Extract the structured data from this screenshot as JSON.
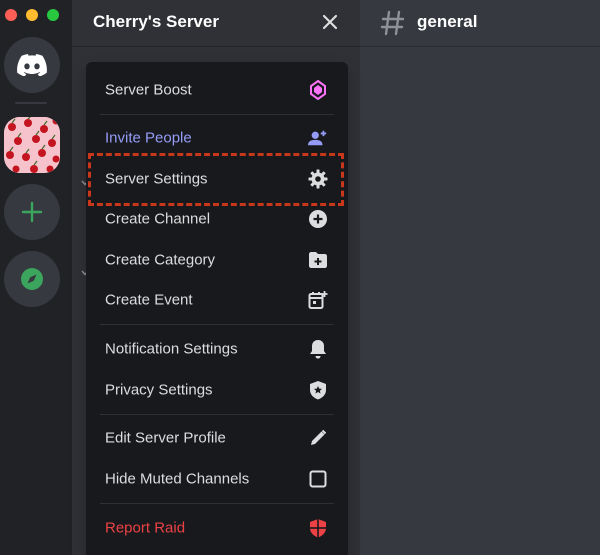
{
  "window": {
    "controls": [
      "close",
      "minimize",
      "zoom"
    ]
  },
  "rail": {
    "home_icon": "discord-logo-icon",
    "add_icon": "plus-icon",
    "explore_icon": "compass-icon",
    "colors": {
      "accent_green": "#3ba55d",
      "rail_bg": "#202225"
    }
  },
  "sidebar": {
    "server_name": "Cherry's Server",
    "close_icon": "close-icon"
  },
  "chat": {
    "channel_name": "general",
    "hash_icon": "hash-icon"
  },
  "menu": {
    "items": [
      {
        "label": "Server Boost",
        "icon": "boost-gem-icon",
        "color": "#dcddde",
        "icon_color": "#ff73fa"
      },
      {
        "label": "Invite People",
        "icon": "add-person-icon",
        "color": "#949cf7",
        "icon_color": "#949cf7"
      },
      {
        "label": "Server Settings",
        "icon": "gear-icon",
        "color": "#dcddde",
        "highlighted": true
      },
      {
        "label": "Create Channel",
        "icon": "plus-circle-icon",
        "color": "#dcddde"
      },
      {
        "label": "Create Category",
        "icon": "folder-plus-icon",
        "color": "#dcddde"
      },
      {
        "label": "Create Event",
        "icon": "calendar-plus-icon",
        "color": "#dcddde"
      },
      {
        "label": "Notification Settings",
        "icon": "bell-icon",
        "color": "#dcddde"
      },
      {
        "label": "Privacy Settings",
        "icon": "shield-star-icon",
        "color": "#dcddde"
      },
      {
        "label": "Edit Server Profile",
        "icon": "pencil-icon",
        "color": "#dcddde"
      },
      {
        "label": "Hide Muted Channels",
        "icon": "checkbox-icon",
        "color": "#dcddde",
        "checked": false
      },
      {
        "label": "Report Raid",
        "icon": "shield-alert-icon",
        "color": "#ed4245",
        "icon_color": "#ed4245"
      }
    ]
  },
  "annotation": {
    "highlight_color": "#c8371b",
    "highlighted_item": "Server Settings"
  }
}
